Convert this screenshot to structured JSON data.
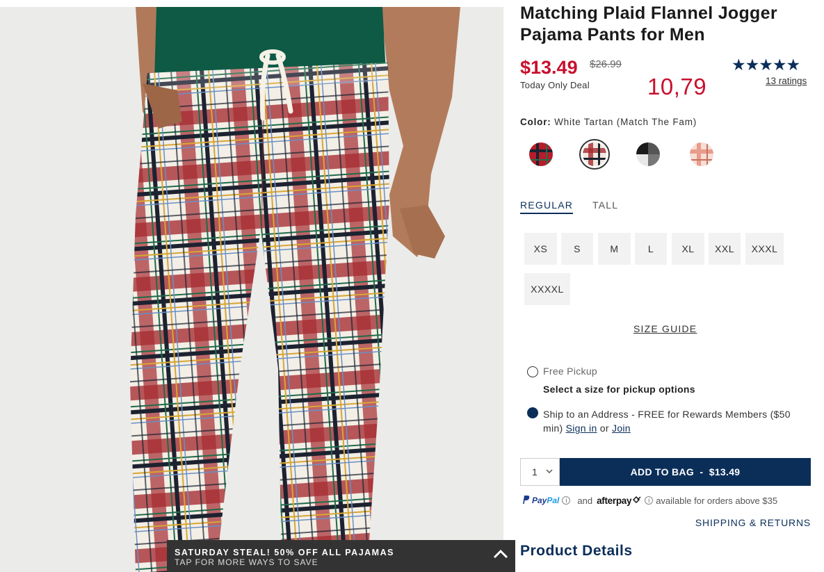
{
  "product": {
    "title": "Matching Plaid Flannel Jogger Pajama Pants for Men",
    "price": "$13.49",
    "original_price": "$26.99",
    "deal_label": "Today Only Deal",
    "annotation": "10,79",
    "rating_stars": "★★★★★",
    "rating_value": 5,
    "ratings_link": "13 ratings"
  },
  "color": {
    "label": "Color:",
    "selected": "White Tartan (Match The Fam)",
    "swatches": [
      "red-tartan",
      "white-tartan",
      "black-white-plaid",
      "pink-plaid"
    ]
  },
  "fit_tabs": [
    "REGULAR",
    "TALL"
  ],
  "sizes": [
    "XS",
    "S",
    "M",
    "L",
    "XL",
    "XXL",
    "XXXL",
    "XXXXL"
  ],
  "size_guide": "SIZE GUIDE",
  "fulfillment": {
    "pickup_label": "Free Pickup",
    "pickup_note": "Select a size for pickup options",
    "ship_text": "Ship to an Address - FREE for Rewards Members ($50 min)",
    "sign_in": "Sign in",
    "or": "or",
    "join": "Join"
  },
  "cart": {
    "quantity": "1",
    "add_to_bag": "ADD TO BAG  -  $13.49"
  },
  "payments": {
    "paypal_a": "Pay",
    "paypal_b": "Pal",
    "and": "and",
    "afterpay": "afterpay",
    "available": "available for orders above $35"
  },
  "links": {
    "shipping_returns": "SHIPPING & RETURNS",
    "product_details": "Product Details"
  },
  "promo": {
    "line1": "SATURDAY STEAL! 50% OFF ALL PAJAMAS",
    "line2": "TAP FOR MORE WAYS TO SAVE"
  },
  "colors": {
    "brand_navy": "#0b2e59",
    "sale_red": "#c8102e",
    "size_bg": "#f2f2f2",
    "promo_bg": "#333333"
  }
}
